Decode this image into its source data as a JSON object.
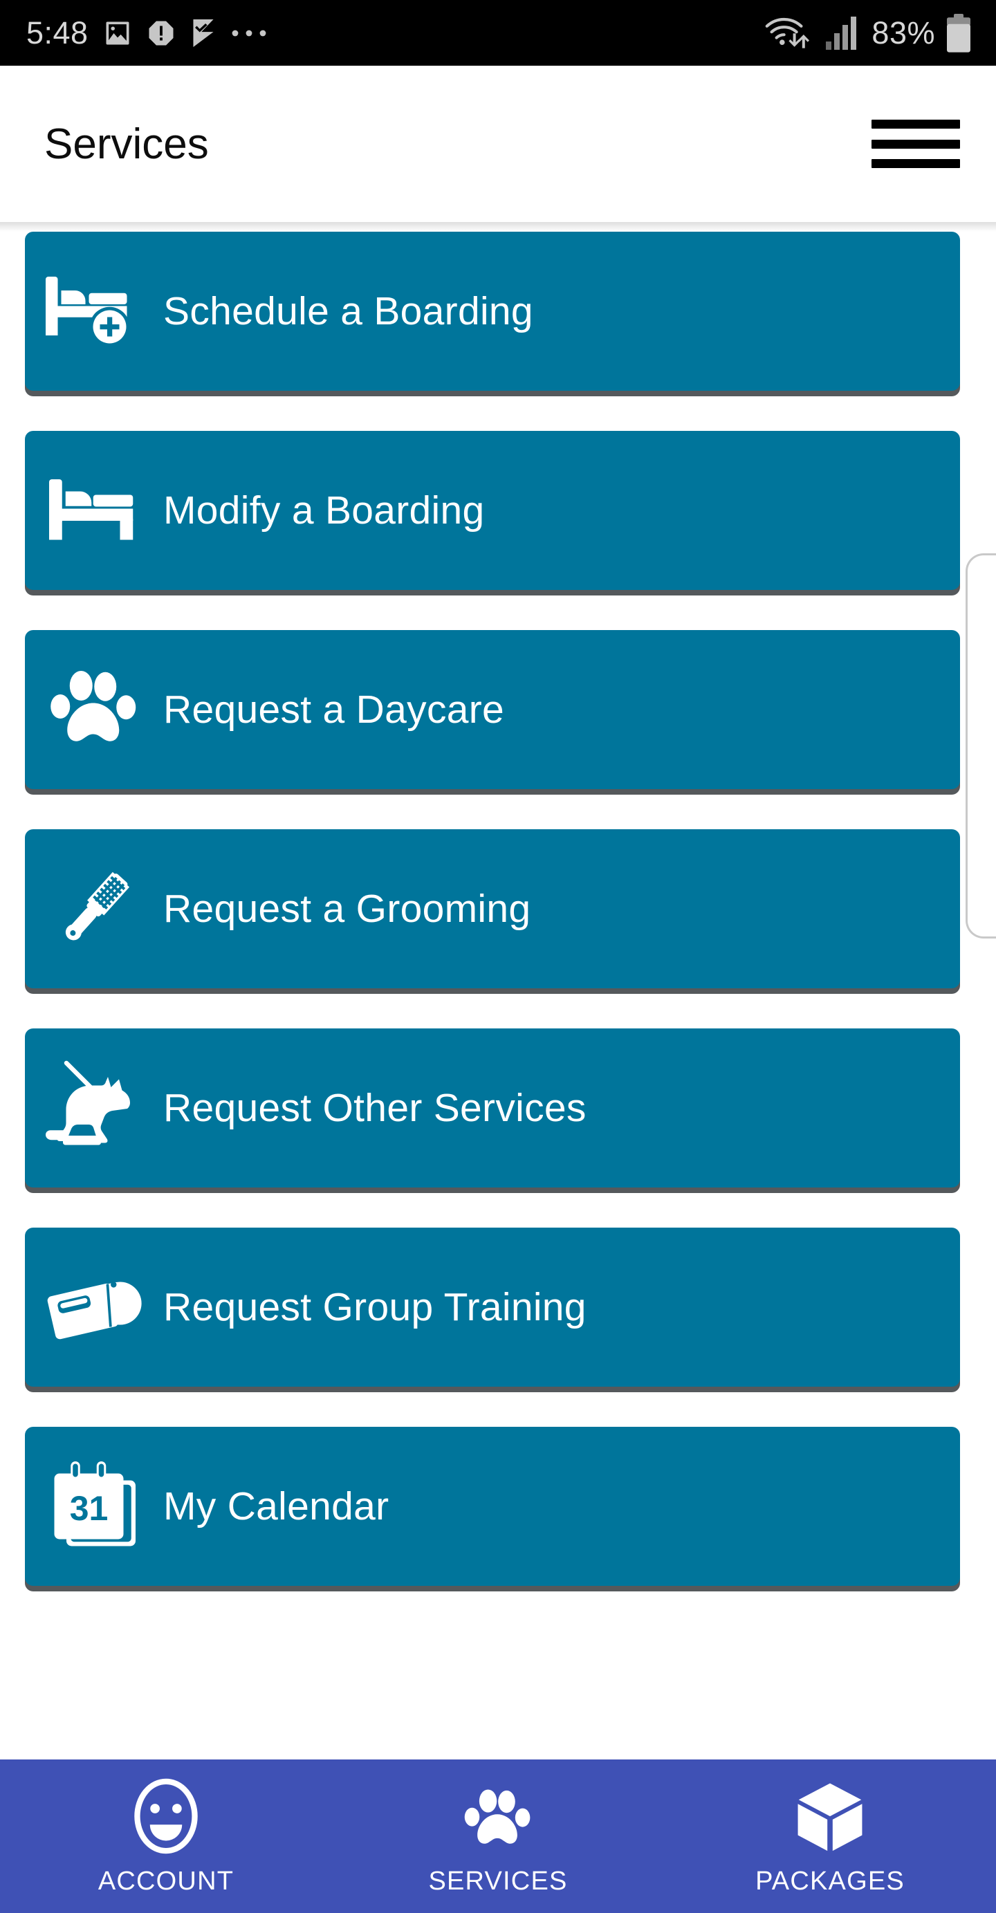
{
  "status_bar": {
    "time": "5:48",
    "battery_percent": "83%",
    "left_icons": [
      "photo-icon",
      "warning-icon",
      "check-flag-icon",
      "more-dots-icon"
    ],
    "right_icons": [
      "wifi-icon",
      "cellular-signal-icon",
      "battery-icon"
    ]
  },
  "app_bar": {
    "title": "Services",
    "menu_icon": "hamburger-menu-icon"
  },
  "services": [
    {
      "label": "Schedule a Boarding",
      "icon": "bed-plus-icon"
    },
    {
      "label": "Modify a Boarding",
      "icon": "bed-icon"
    },
    {
      "label": "Request a Daycare",
      "icon": "paw-print-icon"
    },
    {
      "label": "Request a Grooming",
      "icon": "comb-icon"
    },
    {
      "label": "Request Other Services",
      "icon": "dog-leash-icon"
    },
    {
      "label": "Request Group Training",
      "icon": "whistle-icon"
    },
    {
      "label": "My Calendar",
      "icon": "calendar-31-icon"
    }
  ],
  "calendar_day": "31",
  "bottom_nav": {
    "items": [
      {
        "label": "ACCOUNT",
        "icon": "smiley-face-icon",
        "selected": false
      },
      {
        "label": "SERVICES",
        "icon": "paw-print-icon",
        "selected": true
      },
      {
        "label": "PACKAGES",
        "icon": "box-cube-icon",
        "selected": false
      }
    ]
  },
  "colors": {
    "card_teal": "#00759b",
    "card_shadow": "#55595c",
    "nav_blue": "#3f51b5",
    "status_bar_black": "#000000",
    "app_bar_white": "#ffffff",
    "text_white": "#ffffff",
    "title_black": "#0d0d0d"
  },
  "scrollbar": {
    "name": "vertical-scrollbar"
  }
}
